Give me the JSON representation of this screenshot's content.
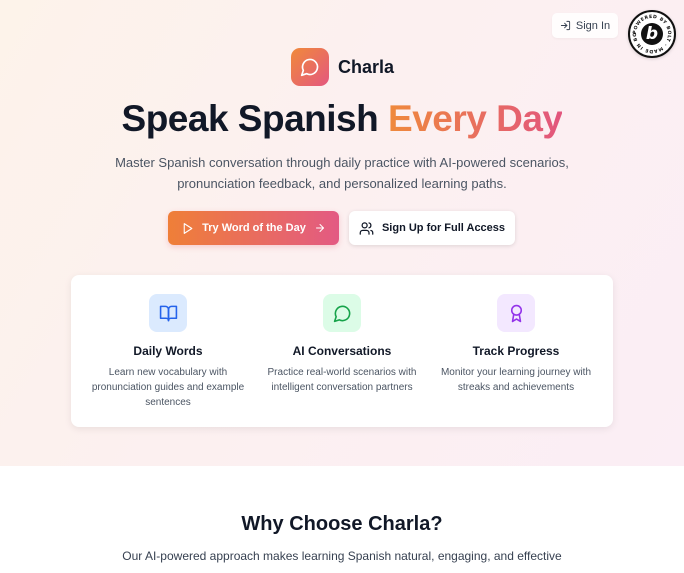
{
  "header": {
    "signin_label": "Sign In",
    "badge_text": "POWERED BY BOLT · MADE IN BOLT · NEW"
  },
  "brand": {
    "name": "Charla",
    "icon": "chat-bubble-icon"
  },
  "hero": {
    "headline_main": "Speak Spanish ",
    "headline_accent": "Every Day",
    "subtitle": "Master Spanish conversation through daily practice with AI-powered scenarios, pronunciation feedback, and personalized learning paths.",
    "primary_cta": "Try Word of the Day",
    "secondary_cta": "Sign Up for Full Access"
  },
  "features": [
    {
      "title": "Daily Words",
      "description": "Learn new vocabulary with pronunciation guides and example sentences",
      "icon": "book-icon",
      "icon_bg": "#dbeafe",
      "icon_color": "#2563eb"
    },
    {
      "title": "AI Conversations",
      "description": "Practice real-world scenarios with intelligent conversation partners",
      "icon": "chat-bubble-icon",
      "icon_bg": "#dcfce7",
      "icon_color": "#16a34a"
    },
    {
      "title": "Track Progress",
      "description": "Monitor your learning journey with streaks and achievements",
      "icon": "award-icon",
      "icon_bg": "#f3e8ff",
      "icon_color": "#9333ea"
    }
  ],
  "why": {
    "title": "Why Choose Charla?",
    "subtitle": "Our AI-powered approach makes learning Spanish natural, engaging, and effective"
  },
  "colors": {
    "accent_start": "#ef8a3c",
    "accent_end": "#e2557e",
    "text_primary": "#111827",
    "text_secondary": "#4b5563"
  }
}
